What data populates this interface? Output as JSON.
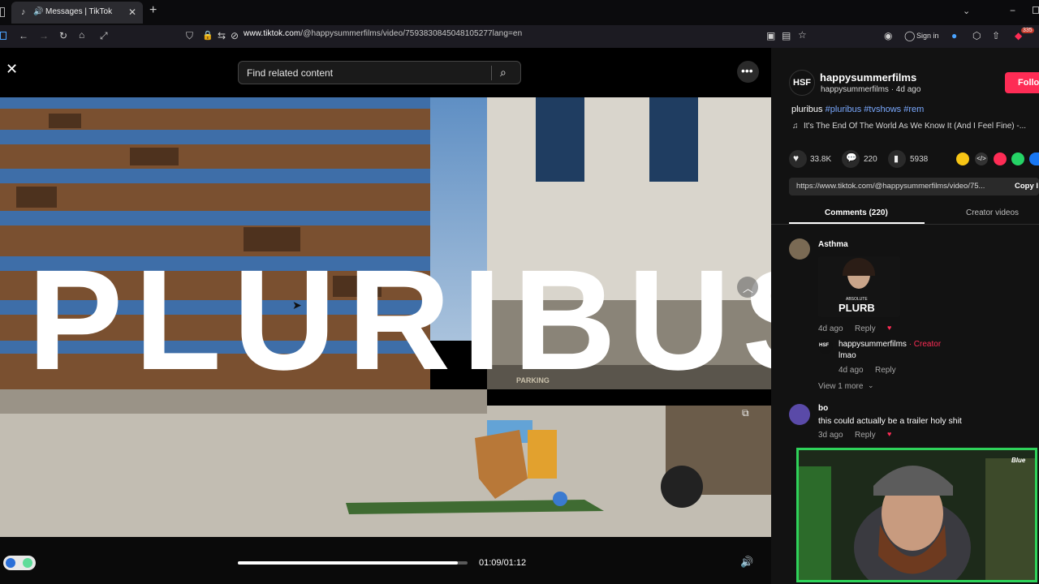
{
  "browser": {
    "tab_title": "Messages | TikTok",
    "url_host": "www.tiktok.com",
    "url_path": "/@happysummerfilms/video/7593830845048105277lang=en",
    "sign_in": "Sign in",
    "badge_count": "335"
  },
  "video": {
    "search_placeholder": "Find related content",
    "title_text": "PLURIBUS",
    "time_display": "01:09/01:12",
    "progress_fraction": 0.958,
    "parking_sign": "PARKING"
  },
  "post": {
    "avatar_text": "HSF",
    "username": "happysummerfilms",
    "meta": "happysummerfilms · 4d ago",
    "follow_label": "Follo",
    "caption_plain": "pluribus",
    "caption_tags": "#pluribus #tvshows #rem",
    "music": "It's The End Of The World As We Know It (And I Feel Fine) -...",
    "likes": "33.8K",
    "comments": "220",
    "saves": "5938",
    "link": "https://www.tiktok.com/@happysummerfilms/video/75...",
    "copy_label": "Copy l"
  },
  "tabs": {
    "comments": "Comments (220)",
    "creator": "Creator videos"
  },
  "comments": [
    {
      "user": "Asthma",
      "sticker_caption": "PLURB",
      "sticker_small": "ABSOLUTE",
      "time": "4d ago",
      "reply": "Reply"
    },
    {
      "user": "happysummerfilms",
      "creator_tag": " · Creator",
      "text": "lmao",
      "time": "4d ago",
      "reply": "Reply"
    },
    {
      "view_more": "View 1 more"
    },
    {
      "user": "bo",
      "text": "this could actually be a trailer holy shit",
      "time": "3d ago",
      "reply": "Reply"
    }
  ],
  "webcam": {
    "cap_text": "Blue"
  },
  "colors": {
    "accent": "#fe2c55",
    "webcam_border": "#2fd25a"
  }
}
